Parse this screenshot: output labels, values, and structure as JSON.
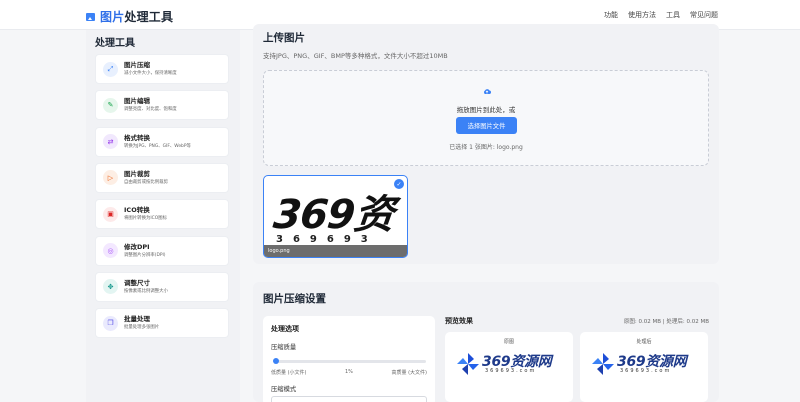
{
  "header": {
    "brand_accent": "图片",
    "brand_rest": "处理工具",
    "nav": [
      "功能",
      "使用方法",
      "工具",
      "常见问题"
    ]
  },
  "sidebar": {
    "title": "处理工具",
    "tools": [
      {
        "title": "图片压缩",
        "sub": "减小文件大小，保持清晰度",
        "icon": "compress-icon",
        "color": "#3b82f6",
        "bg": "#e8f0fe"
      },
      {
        "title": "图片编辑",
        "sub": "调整亮度、对比度、饱和度",
        "icon": "edit-icon",
        "color": "#16a34a",
        "bg": "#e6f6ec"
      },
      {
        "title": "格式转换",
        "sub": "转换为JPG、PNG、GIF、WebP等",
        "icon": "convert-icon",
        "color": "#9333ea",
        "bg": "#f1e8fd"
      },
      {
        "title": "图片裁剪",
        "sub": "自由裁剪或按比例裁剪",
        "icon": "crop-icon",
        "color": "#ea580c",
        "bg": "#fdeee4"
      },
      {
        "title": "ICO转换",
        "sub": "将图片转换为ICO图标",
        "icon": "ico-icon",
        "color": "#dc2626",
        "bg": "#fdeaea"
      },
      {
        "title": "修改DPI",
        "sub": "调整图片分辨率(DPI)",
        "icon": "dpi-icon",
        "color": "#a855f7",
        "bg": "#f3e8ff"
      },
      {
        "title": "调整尺寸",
        "sub": "按像素或比例调整大小",
        "icon": "resize-icon",
        "color": "#0d9488",
        "bg": "#e3f5f2"
      },
      {
        "title": "批量处理",
        "sub": "批量处理多张图片",
        "icon": "batch-icon",
        "color": "#4f46e5",
        "bg": "#eaeafd"
      }
    ]
  },
  "upload": {
    "title": "上传图片",
    "desc": "支持JPG、PNG、GIF、BMP等多种格式，文件大小不超过10MB",
    "drop_text": "拖放图片到此处，或",
    "button": "选择图片文件",
    "selected": "已选择 1 张图片: logo.png",
    "thumb_logo": "369资",
    "thumb_digits": "369693",
    "thumb_name": "logo.png"
  },
  "settings": {
    "title": "图片压缩设置",
    "options_title": "处理选项",
    "quality_label": "压缩质量",
    "quality_value": 1,
    "slider_low": "低质量 (小文件)",
    "slider_val": "1%",
    "slider_high": "高质量 (大文件)",
    "mode_label": "压缩模式",
    "mode_value": "",
    "preview_title": "预览效果",
    "preview_sizes": "原图: 0.02 MB | 处理后: 0.02 MB",
    "preview_original": "原图",
    "preview_processed": "处理后",
    "wm_text": "369资源网",
    "wm_sub": "369693.com"
  },
  "colors": {
    "accent": "#3b82f6",
    "brand": "#2f6fe8"
  }
}
